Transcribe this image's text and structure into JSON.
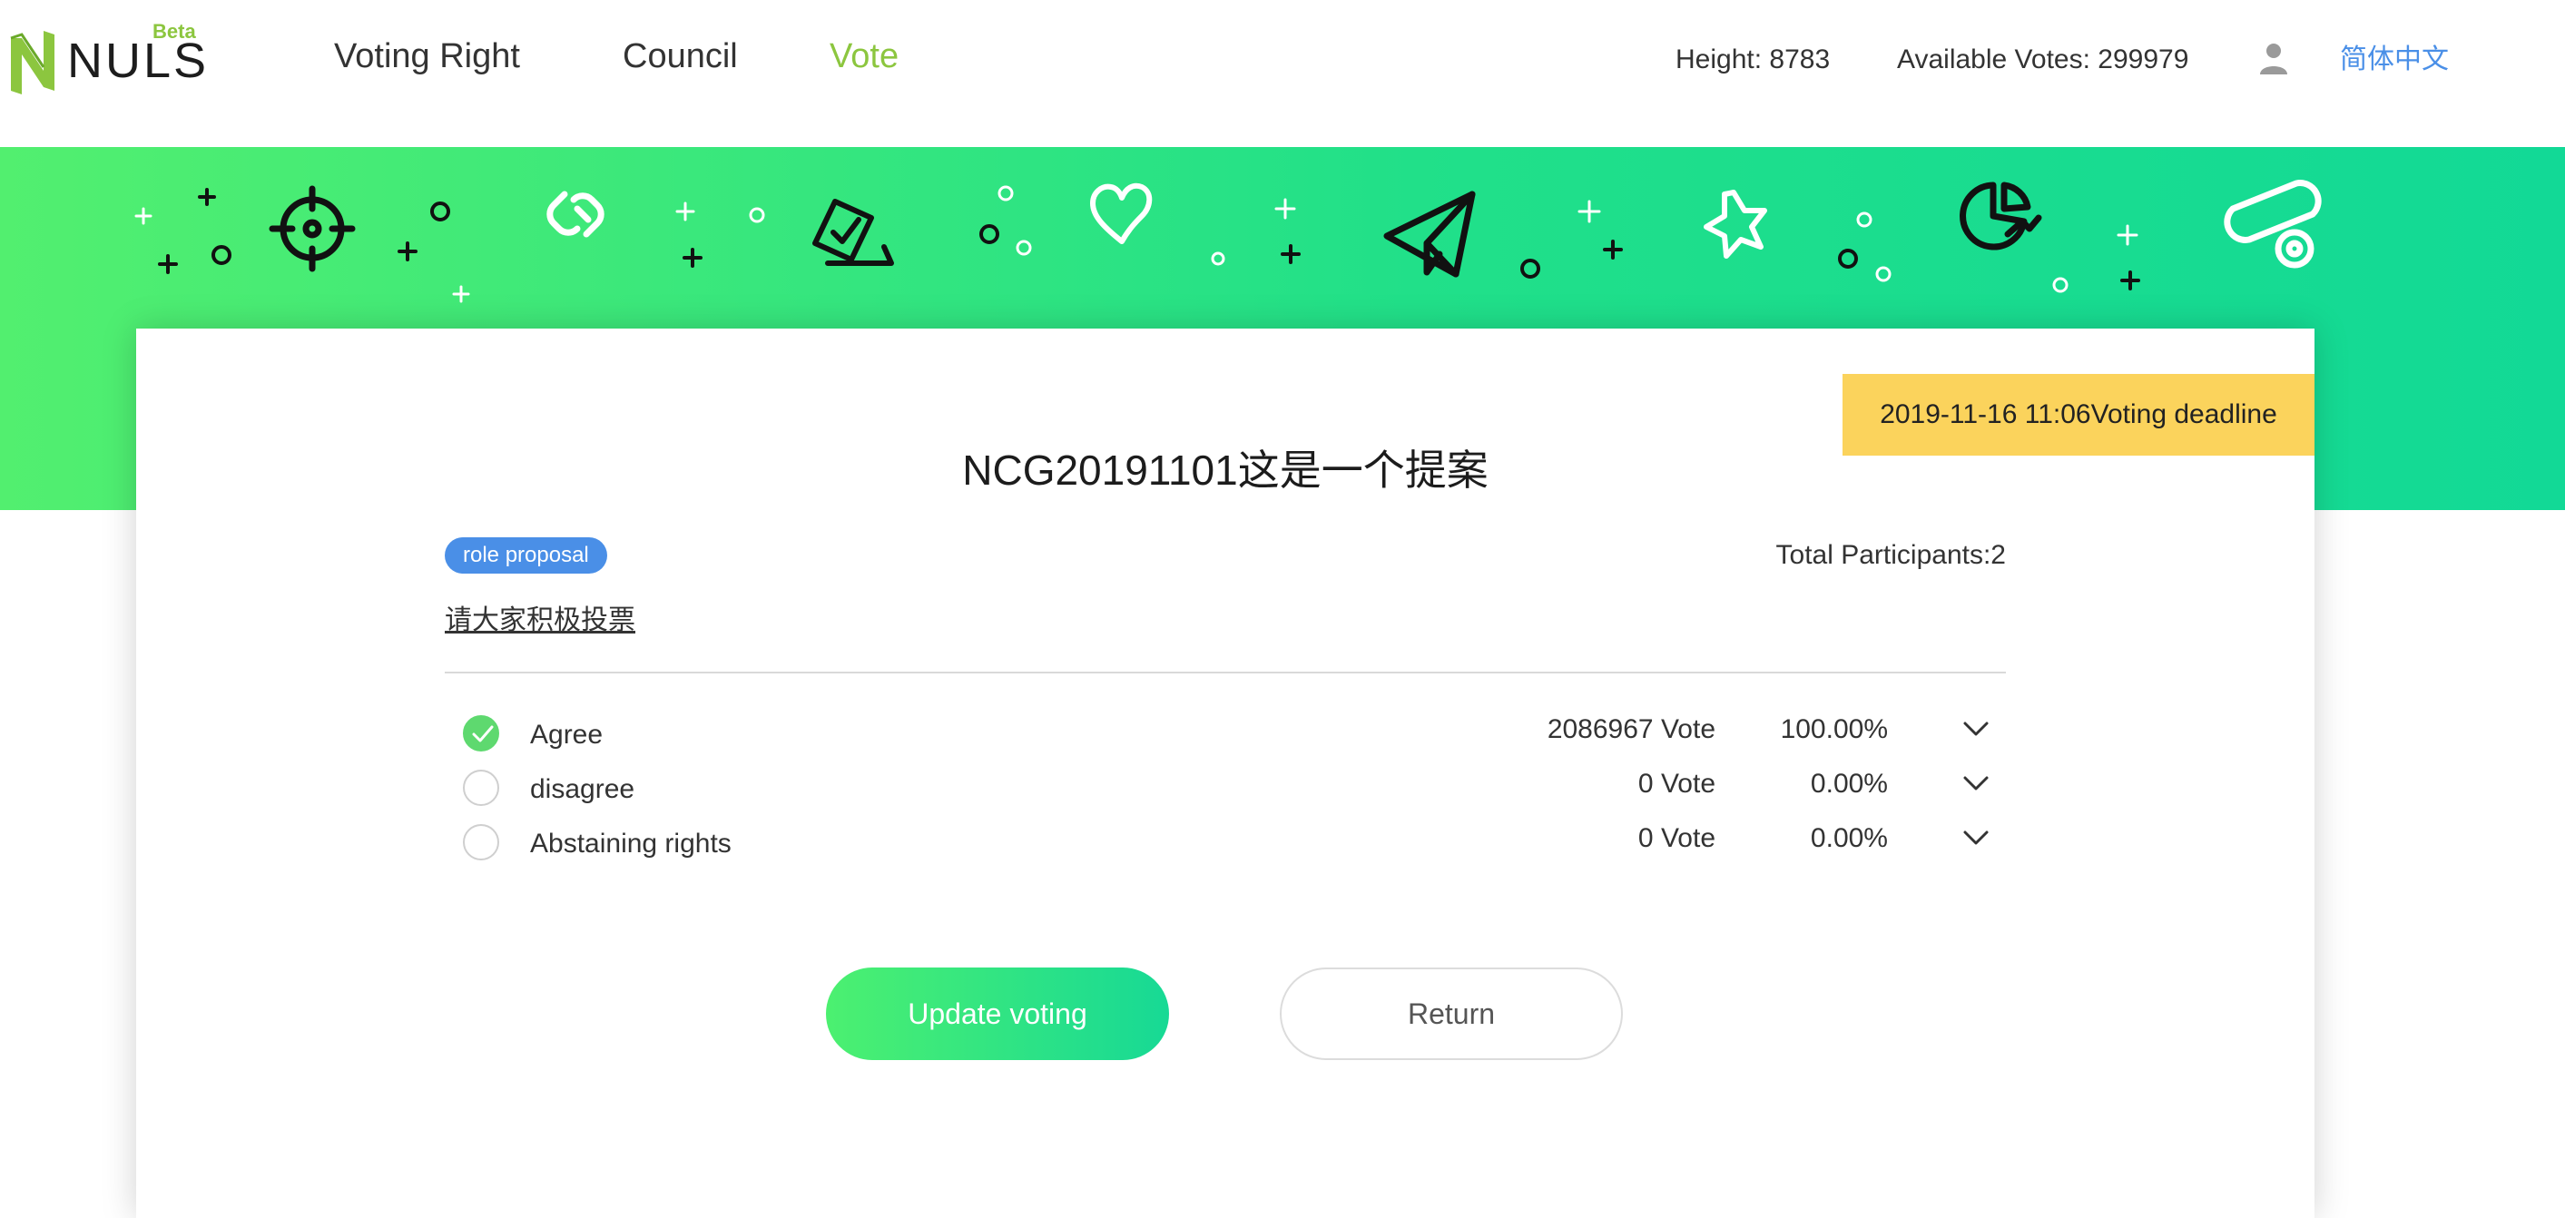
{
  "header": {
    "logo_text": "NULS",
    "logo_badge": "Beta",
    "nav": [
      {
        "label": "Voting Right",
        "active": false
      },
      {
        "label": "Council",
        "active": false
      },
      {
        "label": "Vote",
        "active": true
      }
    ],
    "height_text": "Height: 8783",
    "available_votes_text": "Available Votes: 299979",
    "user_icon": "user-icon",
    "language": "简体中文"
  },
  "banner": {
    "icons": [
      "crosshair-icon",
      "link-icon",
      "ballot-icon",
      "heart-icon",
      "paper-plane-icon",
      "star-icon",
      "pie-chart-icon",
      "key-tag-icon"
    ]
  },
  "proposal": {
    "deadline_date": "2019-11-16 11:06",
    "deadline_label": "Voting deadline",
    "title": "NCG20191101这是一个提案",
    "tag": "role proposal",
    "total_participants": "Total Participants:2",
    "description": "请大家积极投票",
    "options": [
      {
        "label": "Agree",
        "votes": "2086967 Vote",
        "percent": "100.00%",
        "selected": true
      },
      {
        "label": "disagree",
        "votes": "0 Vote",
        "percent": "0.00%",
        "selected": false
      },
      {
        "label": "Abstaining rights",
        "votes": "0 Vote",
        "percent": "0.00%",
        "selected": false
      }
    ]
  },
  "actions": {
    "update_label": "Update voting",
    "return_label": "Return"
  },
  "colors": {
    "accent_green": "#8cc63f",
    "banner_start": "#52ef6f",
    "banner_end": "#12d996",
    "tag_blue": "#4a8fe7",
    "deadline_yellow": "#fbd35c",
    "checked_green": "#5ed96f"
  }
}
